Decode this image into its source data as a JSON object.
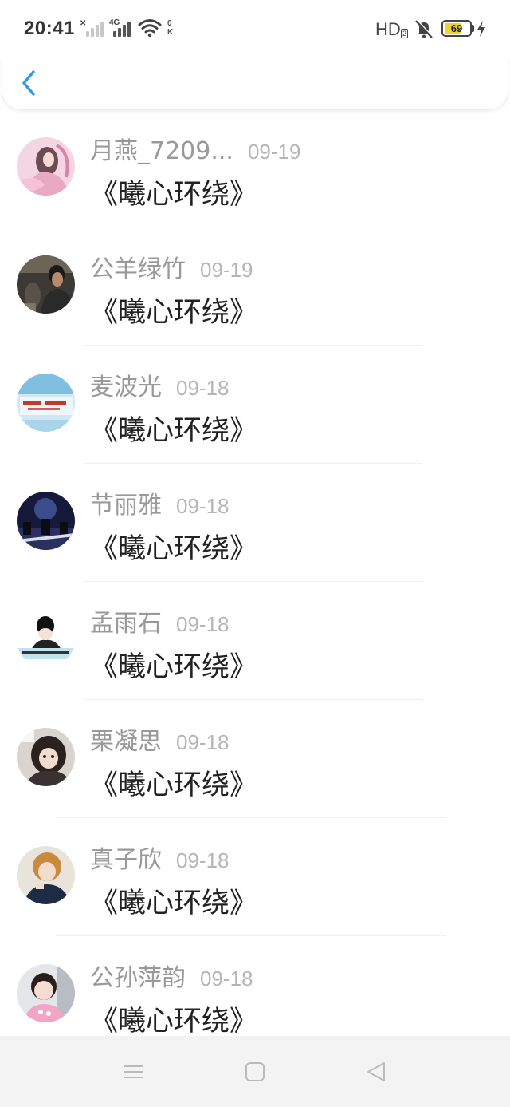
{
  "status_bar": {
    "time": "20:41",
    "network_1": "4G",
    "hd_label": "HD",
    "hd_sub": "2",
    "ok_label": "0\nK",
    "battery_level": "69",
    "battery_fraction": 0.69,
    "battery_color": "#f0d32a"
  },
  "header": {
    "back_icon": "chevron-left-icon",
    "accent_color": "#2f9be8"
  },
  "comments": [
    {
      "name": "月燕_7209...",
      "date": "09-19",
      "text": "《曦心环绕》"
    },
    {
      "name": "公羊绿竹",
      "date": "09-19",
      "text": "《曦心环绕》"
    },
    {
      "name": "麦波光",
      "date": "09-18",
      "text": "《曦心环绕》"
    },
    {
      "name": "节丽雅",
      "date": "09-18",
      "text": "《曦心环绕》"
    },
    {
      "name": "孟雨石",
      "date": "09-18",
      "text": "《曦心环绕》"
    },
    {
      "name": "栗凝思",
      "date": "09-18",
      "text": "《曦心环绕》"
    },
    {
      "name": "真子欣",
      "date": "09-18",
      "text": "《曦心环绕》"
    },
    {
      "name": "公孙萍韵",
      "date": "09-18",
      "text": "《曦心环绕》"
    }
  ],
  "navbar": {
    "icons": [
      "menu-icon",
      "home-square-icon",
      "back-triangle-icon"
    ]
  }
}
